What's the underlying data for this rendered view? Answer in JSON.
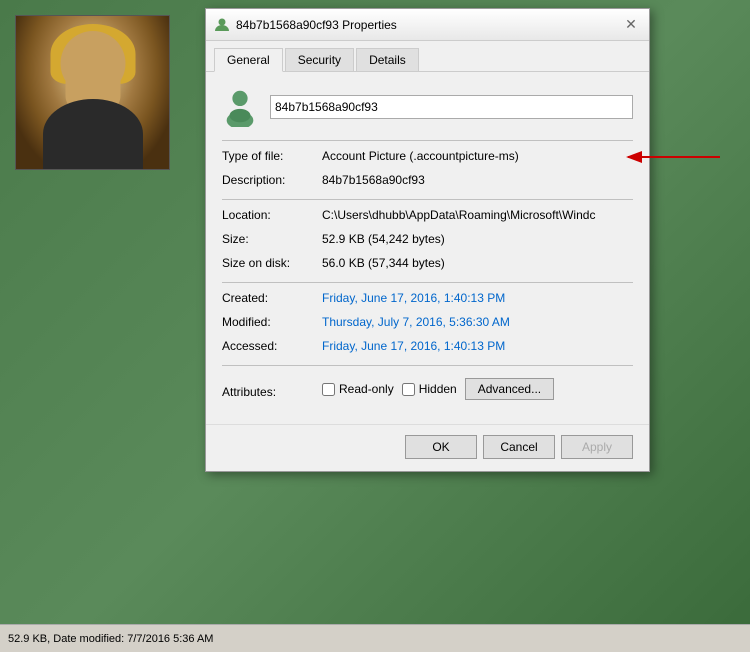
{
  "dialog": {
    "title": "84b7b1568a90cf93 Properties",
    "tabs": [
      {
        "label": "General",
        "active": true
      },
      {
        "label": "Security",
        "active": false
      },
      {
        "label": "Details",
        "active": false
      }
    ],
    "file_name": "84b7b1568a90cf93",
    "properties": {
      "type_of_file_label": "Type of file:",
      "type_of_file_value": "Account Picture (.accountpicture-ms)",
      "description_label": "Description:",
      "description_value": "84b7b1568a90cf93",
      "location_label": "Location:",
      "location_value": "C:\\Users\\dhubb\\AppData\\Roaming\\Microsoft\\Windc",
      "size_label": "Size:",
      "size_value": "52.9 KB (54,242 bytes)",
      "size_on_disk_label": "Size on disk:",
      "size_on_disk_value": "56.0 KB (57,344 bytes)",
      "created_label": "Created:",
      "created_value": "Friday, June 17, 2016, 1:40:13 PM",
      "modified_label": "Modified:",
      "modified_value": "Thursday, July 7, 2016, 5:36:30 AM",
      "accessed_label": "Accessed:",
      "accessed_value": "Friday, June 17, 2016, 1:40:13 PM",
      "attributes_label": "Attributes:",
      "readonly_label": "Read-only",
      "hidden_label": "Hidden",
      "advanced_label": "Advanced..."
    },
    "buttons": {
      "ok": "OK",
      "cancel": "Cancel",
      "apply": "Apply"
    }
  },
  "status_bar": {
    "text": "52.9 KB, Date modified: 7/7/2016 5:36 AM"
  }
}
